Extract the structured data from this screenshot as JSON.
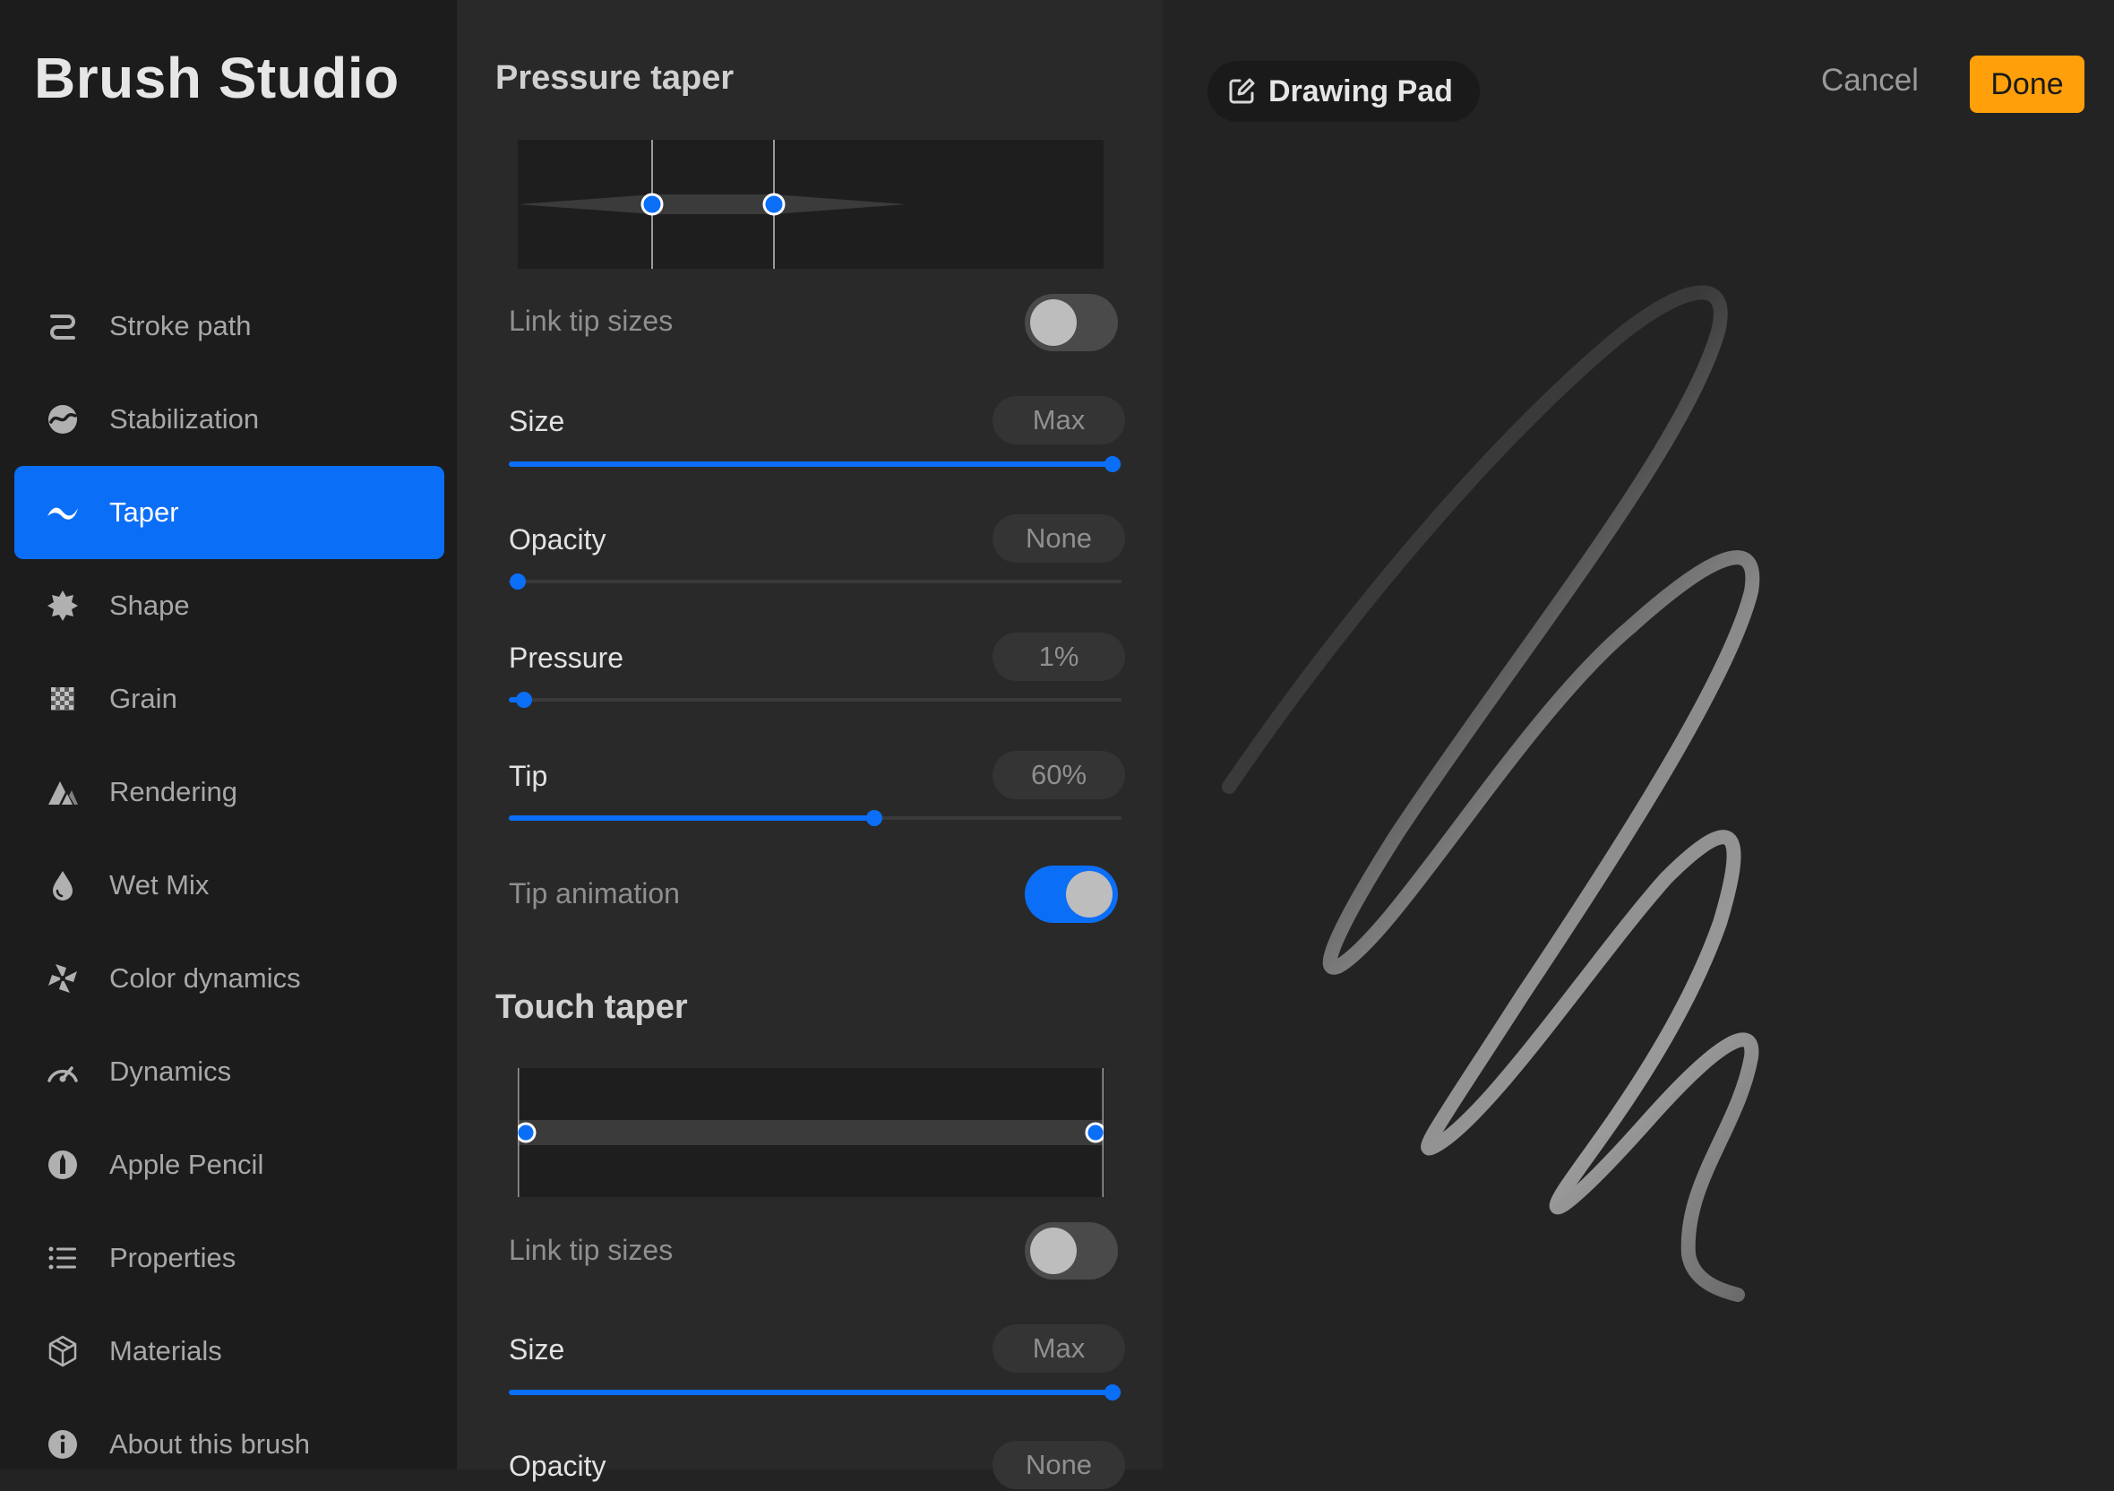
{
  "app": {
    "title": "Brush Studio"
  },
  "sidebar": {
    "items": [
      {
        "label": "Stroke path",
        "icon": "stroke-path-icon",
        "active": false
      },
      {
        "label": "Stabilization",
        "icon": "stabilization-icon",
        "active": false
      },
      {
        "label": "Taper",
        "icon": "taper-icon",
        "active": true
      },
      {
        "label": "Shape",
        "icon": "shape-icon",
        "active": false
      },
      {
        "label": "Grain",
        "icon": "grain-icon",
        "active": false
      },
      {
        "label": "Rendering",
        "icon": "rendering-icon",
        "active": false
      },
      {
        "label": "Wet Mix",
        "icon": "wet-mix-icon",
        "active": false
      },
      {
        "label": "Color dynamics",
        "icon": "color-dynamics-icon",
        "active": false
      },
      {
        "label": "Dynamics",
        "icon": "dynamics-icon",
        "active": false
      },
      {
        "label": "Apple Pencil",
        "icon": "apple-pencil-icon",
        "active": false
      },
      {
        "label": "Properties",
        "icon": "properties-icon",
        "active": false
      },
      {
        "label": "Materials",
        "icon": "materials-icon",
        "active": false
      },
      {
        "label": "About this brush",
        "icon": "info-icon",
        "active": false
      }
    ]
  },
  "pressure_taper": {
    "title": "Pressure taper",
    "link_tip_sizes": {
      "label": "Link tip sizes",
      "on": false
    },
    "size": {
      "label": "Size",
      "value_text": "Max",
      "fraction": 1.0
    },
    "opacity": {
      "label": "Opacity",
      "value_text": "None",
      "fraction": 0.0
    },
    "pressure": {
      "label": "Pressure",
      "value_text": "1%",
      "fraction": 0.01
    },
    "tip": {
      "label": "Tip",
      "value_text": "60%",
      "fraction": 0.6
    },
    "tip_animation": {
      "label": "Tip animation",
      "on": true
    }
  },
  "touch_taper": {
    "title": "Touch taper",
    "link_tip_sizes": {
      "label": "Link tip sizes",
      "on": false
    },
    "size": {
      "label": "Size",
      "value_text": "Max",
      "fraction": 1.0
    },
    "opacity": {
      "label": "Opacity",
      "value_text": "None",
      "fraction": 0.0
    }
  },
  "canvas": {
    "drawing_pad_label": "Drawing Pad",
    "cancel_label": "Cancel",
    "done_label": "Done"
  },
  "colors": {
    "accent": "#0b6ef7",
    "done": "#ff9f0a",
    "background": "#232323"
  }
}
